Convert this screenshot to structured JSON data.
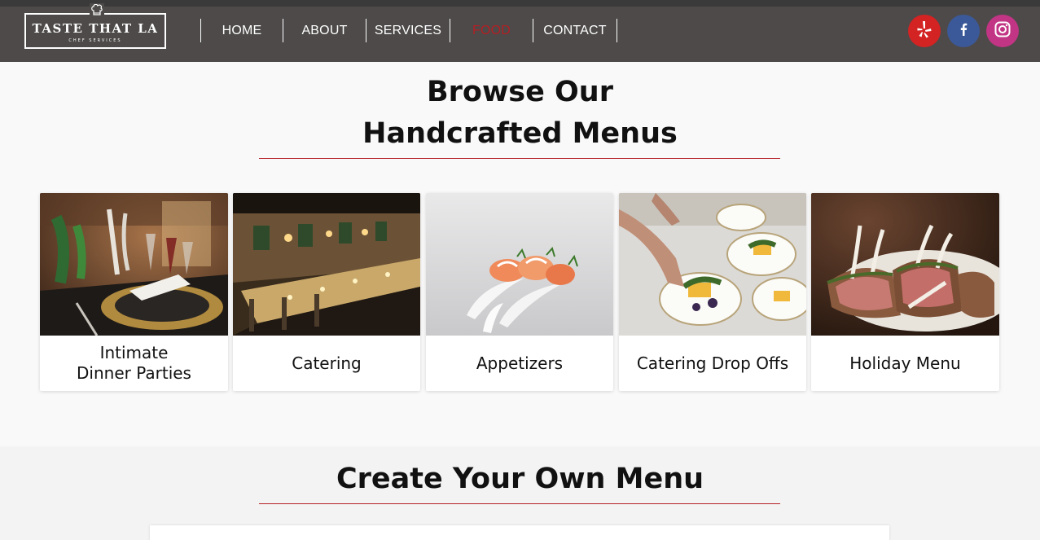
{
  "header": {
    "logo": {
      "title": "TASTE THAT LA",
      "subtitle": "CHEF SERVICES",
      "icon": "chef-hat-icon"
    },
    "nav": [
      {
        "label": "HOME",
        "active": false
      },
      {
        "label": "ABOUT",
        "active": false
      },
      {
        "label": "SERVICES",
        "active": false
      },
      {
        "label": "FOOD",
        "active": true
      },
      {
        "label": "CONTACT",
        "active": false
      }
    ],
    "social": [
      {
        "name": "yelp",
        "icon": "yelp-icon",
        "color": "#d32323"
      },
      {
        "name": "facebook",
        "icon": "facebook-icon",
        "color": "#3b5998"
      },
      {
        "name": "instagram",
        "icon": "instagram-icon",
        "color": "#c13584"
      }
    ]
  },
  "browse": {
    "title_line1": "Browse Our",
    "title_line2": "Handcrafted Menus",
    "cards": [
      {
        "label": "Intimate\nDinner Parties",
        "image": "table-setting-photo"
      },
      {
        "label": "Catering",
        "image": "banquet-hall-photo"
      },
      {
        "label": "Appetizers",
        "image": "shrimp-spoons-photo"
      },
      {
        "label": "Catering Drop Offs",
        "image": "plated-dishes-photo"
      },
      {
        "label": "Holiday Menu",
        "image": "lamb-rack-photo"
      }
    ]
  },
  "create": {
    "title": "Create Your Own Menu"
  },
  "colors": {
    "accent": "#b51f24",
    "header_bg": "#4d4a49"
  }
}
